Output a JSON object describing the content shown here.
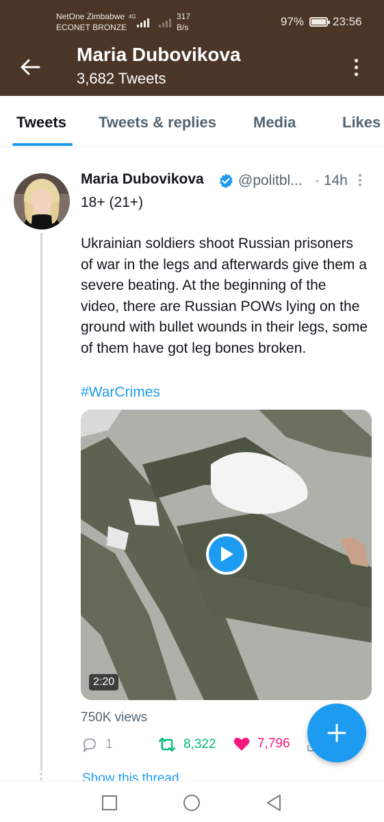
{
  "status_bar": {
    "carrier_1": "NetOne Zimbabwe",
    "carrier_2": "ECONET BRONZE",
    "network": "4G",
    "speed_value": "317",
    "speed_unit": "B/s",
    "battery": "97%",
    "time": "23:56"
  },
  "header": {
    "title": "Maria Dubovikova",
    "subtitle": "3,682 Tweets",
    "back_icon": "arrow-left-icon",
    "menu_icon": "more-vertical-icon"
  },
  "tabs": [
    {
      "label": "Tweets",
      "active": true
    },
    {
      "label": "Tweets & replies",
      "active": false
    },
    {
      "label": "Media",
      "active": false
    },
    {
      "label": "Likes",
      "active": false
    }
  ],
  "tweet": {
    "author_name": "Maria Dubovikova",
    "handle": "@politbl...",
    "time": "· 14h",
    "subtitle": "18+ (21+)",
    "text": "Ukrainian soldiers shoot Russian prisoners of war in the legs and afterwards give them a severe beating. At the beginning of the video, there are Russian POWs lying on the ground with bullet wounds in their legs, some of them have got leg bones broken.",
    "hashtag": "#WarCrimes",
    "video_duration": "2:20",
    "views": "750K views",
    "replies": "1",
    "retweets": "8,322",
    "likes": "7,796",
    "show_thread": "Show this thread"
  },
  "colors": {
    "header_bg": "#4a3526",
    "accent": "#1d9bf0",
    "retweet": "#00ba7c",
    "like": "#f91880",
    "muted": "#536471"
  }
}
